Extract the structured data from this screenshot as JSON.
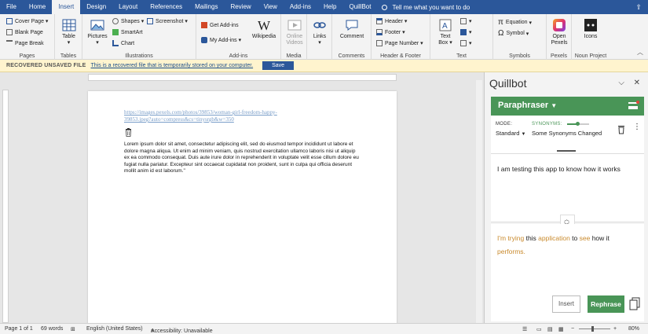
{
  "tabs": [
    "File",
    "Home",
    "Insert",
    "Design",
    "Layout",
    "References",
    "Mailings",
    "Review",
    "View",
    "Add-ins",
    "Help",
    "QuillBot"
  ],
  "active_tab": "Insert",
  "tell_me": "Tell me what you want to do",
  "ribbon": {
    "pages": {
      "items": [
        "Cover Page",
        "Blank Page",
        "Page Break"
      ],
      "label": "Pages"
    },
    "tables": {
      "item": "Table",
      "label": "Tables"
    },
    "illustrations": {
      "pictures": "Pictures",
      "shapes": "Shapes",
      "smartart": "SmartArt",
      "chart": "Chart",
      "screenshot": "Screenshot",
      "label": "Illustrations"
    },
    "addins": {
      "get": "Get Add-ins",
      "my": "My Add-ins",
      "wikipedia": "Wikipedia",
      "label": "Add-ins"
    },
    "media": {
      "online_videos_l1": "Online",
      "online_videos_l2": "Videos",
      "label": "Media"
    },
    "links": {
      "item": "Links"
    },
    "comments": {
      "item": "Comment",
      "label": "Comments"
    },
    "header_footer": {
      "header": "Header",
      "footer": "Footer",
      "page_number": "Page Number",
      "label": "Header & Footer"
    },
    "text": {
      "text_box_l1": "Text",
      "text_box_l2": "Box",
      "label": "Text"
    },
    "symbols": {
      "equation": "Equation",
      "symbol": "Symbol",
      "label": "Symbols"
    },
    "pexels": {
      "open_l1": "Open",
      "open_l2": "Pexels",
      "label": "Pexels"
    },
    "noun": {
      "icons": "Icons",
      "label": "Noun Project"
    }
  },
  "message_bar": {
    "title": "RECOVERED UNSAVED FILE",
    "text": "This is a recovered file that is temporarily stored on your computer.",
    "button": "Save"
  },
  "document": {
    "link_line1": "https://images.pexels.com/photos/39853/woman-girl-freedom-happy-",
    "link_line2": "39853.jpeg?auto=compress&cs=tinysrgb&w=350",
    "paragraph": "Lorem ipsum dolor sit amet, consectetur adipiscing elit, sed do eiusmod tempor incididunt ut labore et dolore magna aliqua. Ut enim ad minim veniam, quis nostrud exercitation ullamco laboris nisi ut aliquip ex ea commodo consequat. Duis aute irure dolor in reprehenderit in voluptate velit esse cillum dolore eu fugiat nulla pariatur. Excepteur sint occaecat cupidatat non proident, sunt in culpa qui officia deserunt mollit anim id est laborum.\""
  },
  "quillbot": {
    "pane_title": "Quillbot",
    "mode_header": "Paraphraser",
    "mode_label": "MODE:",
    "mode_value": "Standard",
    "synonyms_label": "SYNONYMS:",
    "synonyms_value": "Some Synonyms Changed",
    "input_text": "I am testing this app to know how it works",
    "output": [
      {
        "text": "I'm trying",
        "changed": true
      },
      {
        "text": " this ",
        "changed": false
      },
      {
        "text": "application",
        "changed": true
      },
      {
        "text": " to ",
        "changed": false
      },
      {
        "text": "see",
        "changed": true
      },
      {
        "text": " how it ",
        "changed": false
      },
      {
        "text": "performs.",
        "changed": true
      }
    ],
    "insert_button": "Insert",
    "rephrase_button": "Rephrase",
    "accent_color": "#499557",
    "changed_color": "#c98a2d"
  },
  "status": {
    "page": "Page 1 of 1",
    "words": "69 words",
    "language": "English (United States)",
    "accessibility": "Accessibility: Unavailable",
    "zoom": "80%"
  }
}
